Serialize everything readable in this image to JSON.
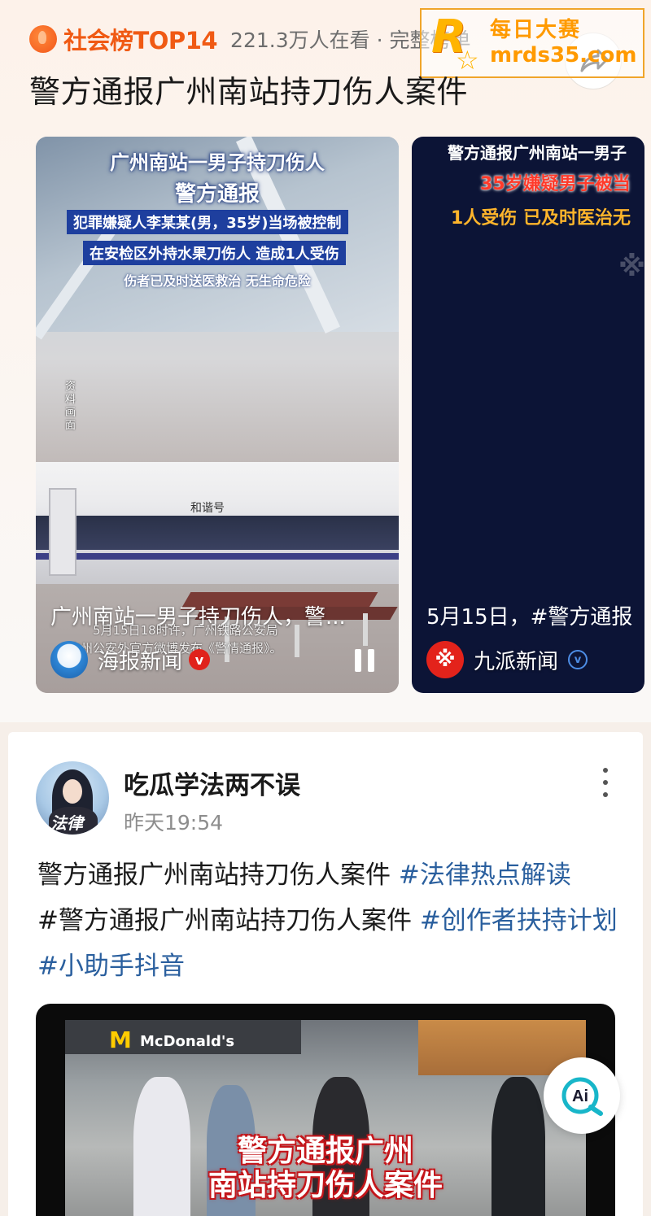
{
  "hot_topic": {
    "rank_label": "社会榜TOP14",
    "viewer_text": "221.3万人在看 · 完整榜单",
    "title": "警方通报广州南站持刀伤人案件",
    "accent_color": "#f05a14"
  },
  "watermark": {
    "brand_line": "每日大赛",
    "url": "mrds35.com"
  },
  "videos": [
    {
      "overlay_line1": "广州南站一男子持刀伤人",
      "overlay_line2": "警方通报",
      "overlay_banner1": "犯罪嫌疑人李某某(男，35岁)当场被控制",
      "overlay_banner2": "在安检区外持水果刀伤人 造成1人受伤",
      "overlay_line3": "伤者已及时送医救治 无生命危险",
      "side_note": "资料画面",
      "train_name": "和谐号",
      "caption": "广州南站一男子持刀伤人，警...",
      "subtitle_line1": "5月15日18时许，广州铁路公安局",
      "subtitle_line2": "广州公安外官方微博发布《警情通报》。",
      "source": "海报新闻",
      "verified_icon": "v"
    },
    {
      "overlay_line1": "警方通报广州南站一男子",
      "overlay_line2": "35岁嫌疑男子被当",
      "overlay_line3": "1人受伤 已及时医治无",
      "caption": "5月15日，#警方通报",
      "source": "九派新闻",
      "verified_icon": "v"
    }
  ],
  "post": {
    "author": "吃瓜学法两不误",
    "avatar_text": "法律",
    "time": "昨天19:54",
    "text_plain_1": "警方通报广州南站持刀伤人案件 ",
    "tag_1": "#法律热点解读",
    "tag_2_prefix": "#警方通报广州南站持刀伤人案件 ",
    "tag_3": "#创作者扶持计划",
    "tag_4": "#小助手抖音",
    "hashtag_color": "#2a5f9e",
    "media": {
      "store_sign_m": "M",
      "store_sign_text": "McDonald's",
      "title_line1": "警方通报广州",
      "title_line2": "南站持刀伤人案件"
    }
  },
  "ai_button": {
    "label": "Ai"
  }
}
